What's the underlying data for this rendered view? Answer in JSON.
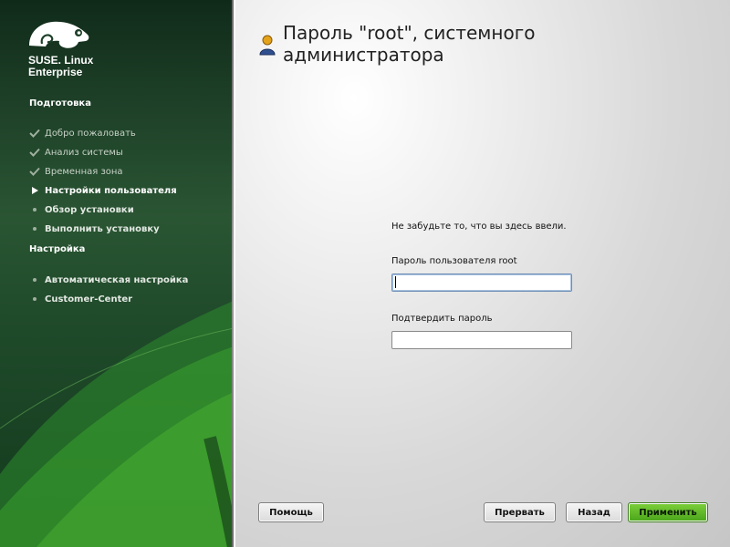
{
  "sidebar": {
    "brand_line1": "SUSE. Linux",
    "brand_line2": "Enterprise",
    "sections": [
      {
        "title": "Подготовка",
        "items": [
          {
            "label": "Добро пожаловать",
            "state": "done"
          },
          {
            "label": "Анализ системы",
            "state": "done"
          },
          {
            "label": "Временная зона",
            "state": "done"
          },
          {
            "label": "Настройки пользователя",
            "state": "current"
          },
          {
            "label": "Обзор установки",
            "state": "todo"
          },
          {
            "label": "Выполнить установку",
            "state": "todo"
          }
        ]
      },
      {
        "title": "Настройка",
        "items": [
          {
            "label": "Автоматическая настройка",
            "state": "todo"
          },
          {
            "label": "Customer-Center",
            "state": "todo"
          }
        ]
      }
    ]
  },
  "main": {
    "title": "Пароль \"root\", системного администратора",
    "hint": "Не забудьте то, что вы здесь ввели.",
    "password_label": "Пароль пользователя root",
    "password_value": "",
    "confirm_label": "Подтвердить пароль",
    "confirm_value": ""
  },
  "buttons": {
    "help": "Помощь",
    "abort": "Прервать",
    "back": "Назад",
    "apply": "Применить"
  },
  "colors": {
    "accent": "#4aa51a",
    "sidebar": "#1f4a2a"
  }
}
